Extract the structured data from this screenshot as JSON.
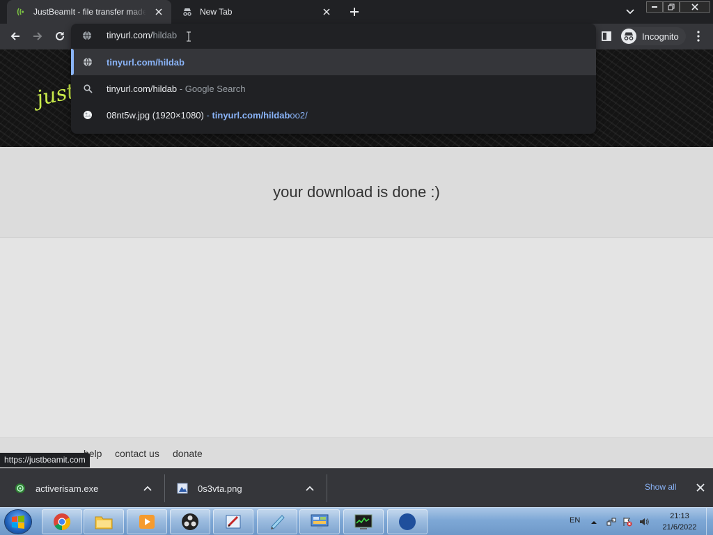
{
  "browser": {
    "tabs": [
      {
        "title": "JustBeamIt - file transfer made easy",
        "active": true
      },
      {
        "title": "New Tab",
        "active": false
      }
    ],
    "incognito_label": "Incognito",
    "omnibox": {
      "typed": "tinyurl.com/",
      "inline_completion": "hildab"
    },
    "suggestions": [
      {
        "url_bold": "tinyurl.com/hildab",
        "icon": "globe-icon"
      },
      {
        "query": "tinyurl.com/hildab",
        "suffix": " - Google Search",
        "icon": "search-icon"
      },
      {
        "name": "08nt5w.jpg (1920×1080)",
        "separator": " - ",
        "url_match": "tinyurl.com/hildab",
        "url_rest": "oo2/",
        "icon": "image-favicon"
      }
    ],
    "status_url": "https://justbeamit.com"
  },
  "page": {
    "logo": "just",
    "message": "your download is done :)",
    "footer_links": [
      "help",
      "contact us",
      "donate"
    ]
  },
  "downloads": {
    "items": [
      {
        "name": "activerisam.exe",
        "icon": "green-app-icon"
      },
      {
        "name": "0s3vta.png",
        "icon": "image-file-icon"
      }
    ],
    "show_all": "Show all"
  },
  "taskbar": {
    "apps": [
      "chrome",
      "file-explorer",
      "media-player",
      "obs",
      "paint",
      "notepad",
      "control-panel",
      "task-manager",
      "security"
    ],
    "language": "EN",
    "time": "21:13",
    "date": "21/6/2022"
  },
  "colors": {
    "accent": "#8ab4f8",
    "tab_strip": "#202124",
    "toolbar": "#35363a",
    "logo": "#c9ea4a"
  }
}
